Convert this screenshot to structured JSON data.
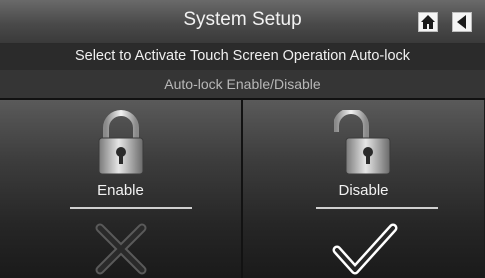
{
  "header": {
    "title": "System Setup",
    "home_icon": "home-icon",
    "back_icon": "back-arrow-icon"
  },
  "instruction": "Select to Activate Touch Screen Operation Auto-lock",
  "subtitle": "Auto-lock Enable/Disable",
  "options": [
    {
      "label": "Enable",
      "icon": "padlock-closed-icon",
      "selected": false
    },
    {
      "label": "Disable",
      "icon": "padlock-open-icon",
      "selected": true
    }
  ],
  "colors": {
    "title_text": "#f2f2f2",
    "subtitle_text": "#b8b8b8",
    "check_active": "#ffffff",
    "x_inactive": "#5a5a5a"
  }
}
